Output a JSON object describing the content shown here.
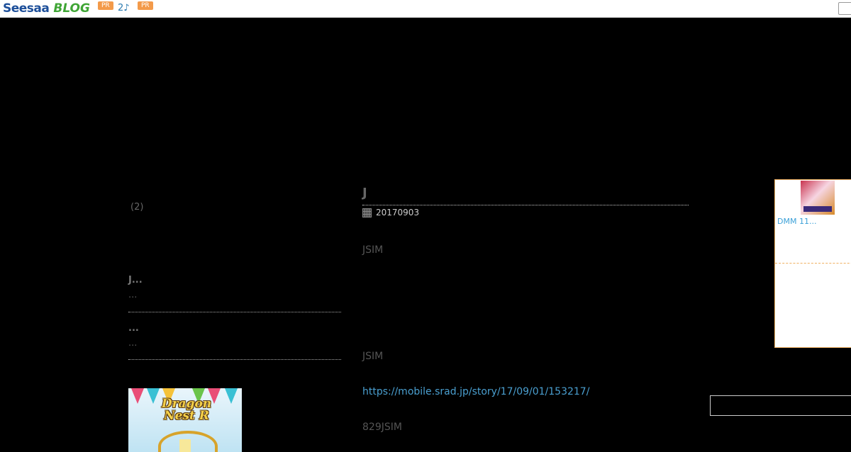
{
  "topbar": {
    "logo_seesaa": "Seesaa",
    "logo_blog": "BLOG",
    "pr_label_1": "PR",
    "link_text": "2♪",
    "pr_label_2": "PR"
  },
  "sidebar": {
    "count_text": "(2)",
    "entries": [
      {
        "title": "J...",
        "snippet": "..."
      },
      {
        "title": "...",
        "snippet": "..."
      }
    ],
    "ad": {
      "title": "Dragon Nest R"
    }
  },
  "post": {
    "title": "J",
    "date": "20170903",
    "paragraph_1": "JSIM",
    "paragraph_2": "JSIM",
    "link": "https://mobile.srad.jp/story/17/09/01/153217/",
    "paragraph_4": "829JSIM"
  },
  "right_ad": {
    "label": "DMM 11..."
  },
  "colors": {
    "background": "#000000",
    "link": "#4a9fd0",
    "pr_badge": "#f39a4a",
    "ad_border": "#f0b060"
  },
  "icons": {
    "date_icon": "calendar-icon"
  }
}
